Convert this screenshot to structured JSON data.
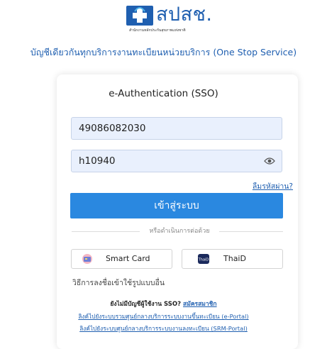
{
  "logo": {
    "name": "สปสช.",
    "subtitle": "สำนักงานหลักประกันสุขภาพแห่งชาติ"
  },
  "heading": "บัญชีเดียวกันทุกบริการงานทะเบียนหน่วยบริการ (One Stop Service)",
  "card": {
    "title": "e-Authentication (SSO)",
    "username_value": "49086082030",
    "password_value": "h10940",
    "forgot_link": "ลืมรหัสผ่าน?",
    "login_button": "เข้าสู่ระบบ",
    "divider_text": "หรือดำเนินการต่อด้วย",
    "smartcard_button": "Smart Card",
    "thaid_button": "ThaiD",
    "other_methods": "วิธีการลงชื่อเข้าใช้รูปแบบอื่น",
    "no_account_text": "ยังไม่มีบัญชีผู้ใช้งาน SSO?",
    "register_link": "สมัครสมาชิก",
    "link_eportal": "ลิงค์ไปยังระบบรวมศูนย์กลางบริการระบบงานขึ้นทะเบียน (e-Portal)",
    "link_srm": "ลิงค์ไปยังระบบศูนย์กลางบริการระบบงานลงทะเบียน (SRM-Portal)"
  },
  "icons": {
    "logo": "nhso-cross-logo",
    "password_toggle": "eye-icon",
    "smartcard": "smart-card-icon",
    "thaid": "thaid-icon"
  },
  "colors": {
    "brand_blue": "#1f5fb0",
    "login_button": "#2a88e0",
    "input_bg": "#e9f0fd"
  }
}
